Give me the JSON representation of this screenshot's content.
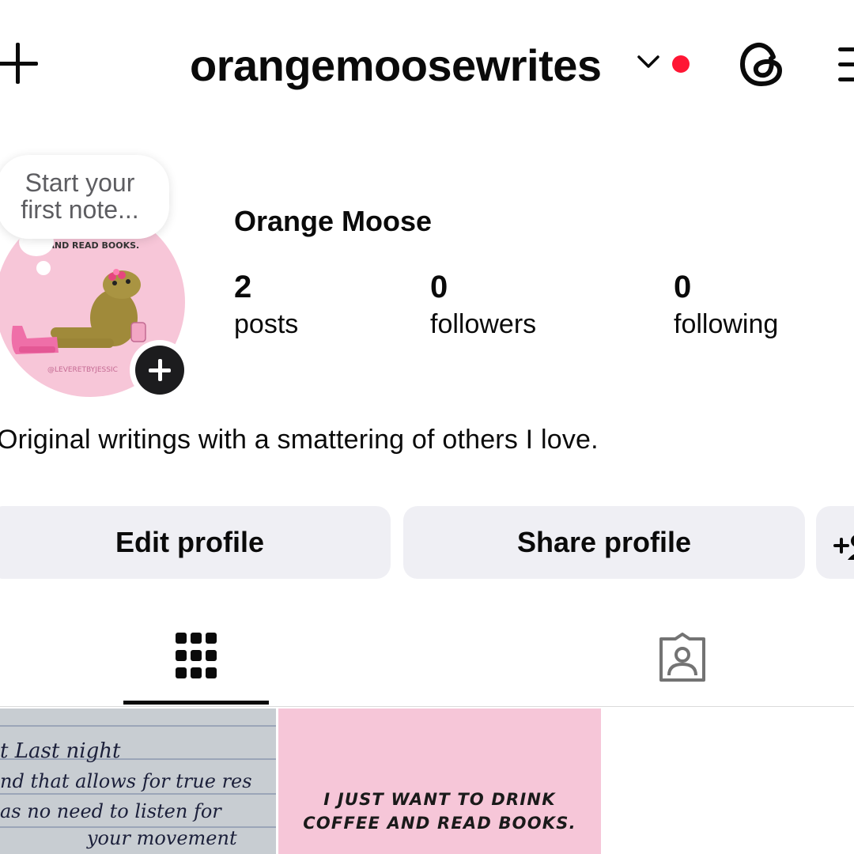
{
  "header": {
    "username": "orangemoosewrites"
  },
  "note": {
    "placeholder": "Start your first note..."
  },
  "profile": {
    "display_name": "Orange Moose",
    "stats": [
      {
        "count": "2",
        "label": "posts"
      },
      {
        "count": "0",
        "label": "followers"
      },
      {
        "count": "0",
        "label": "following"
      }
    ],
    "bio": "Original writings with a smattering of others I love."
  },
  "buttons": {
    "edit": "Edit profile",
    "share": "Share profile"
  },
  "tabs": {
    "active": "grid",
    "items": [
      "grid-icon",
      "tagged-icon"
    ]
  },
  "posts": [
    {
      "type": "handwritten-note",
      "lines": [
        "t Last night",
        "nd that allows for true res",
        "as no need to listen for",
        "your movement"
      ]
    },
    {
      "type": "quote",
      "lines": [
        "I JUST WANT TO DRINK",
        "COFFEE AND READ BOOKS."
      ]
    }
  ],
  "avatar": {
    "art_text_top": "E AND READ BOOKS.",
    "art_text_bottom": "@LEVERETBYJESSIC"
  },
  "colors": {
    "notification_dot": "#ff1634",
    "button_bg": "#efeff4",
    "avatar_bg": "#f7c6d8",
    "quote_post_bg": "#f6c6d8"
  }
}
